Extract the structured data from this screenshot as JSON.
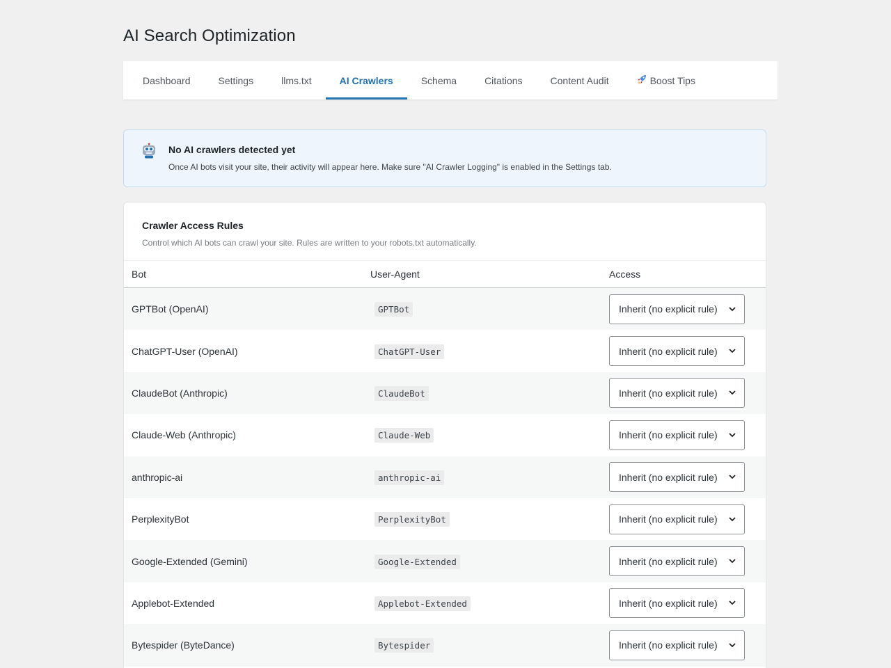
{
  "page": {
    "title": "AI Search Optimization"
  },
  "tabs": [
    {
      "label": "Dashboard"
    },
    {
      "label": "Settings"
    },
    {
      "label": "llms.txt"
    },
    {
      "label": "AI Crawlers",
      "active": true
    },
    {
      "label": "Schema"
    },
    {
      "label": "Citations"
    },
    {
      "label": "Content Audit"
    },
    {
      "label": "Boost Tips",
      "icon": "rocket-icon"
    }
  ],
  "notice": {
    "icon": "robot-icon",
    "title": "No AI crawlers detected yet",
    "text": "Once AI bots visit your site, their activity will appear here. Make sure \"AI Crawler Logging\" is enabled in the Settings tab."
  },
  "rules": {
    "title": "Crawler Access Rules",
    "subtitle": "Control which AI bots can crawl your site. Rules are written to your robots.txt automatically.",
    "columns": [
      "Bot",
      "User-Agent",
      "Access"
    ],
    "rows": [
      {
        "bot": "GPTBot (OpenAI)",
        "ua": "GPTBot",
        "access": "Inherit (no explicit rule)"
      },
      {
        "bot": "ChatGPT-User (OpenAI)",
        "ua": "ChatGPT-User",
        "access": "Inherit (no explicit rule)"
      },
      {
        "bot": "ClaudeBot (Anthropic)",
        "ua": "ClaudeBot",
        "access": "Inherit (no explicit rule)"
      },
      {
        "bot": "Claude-Web (Anthropic)",
        "ua": "Claude-Web",
        "access": "Inherit (no explicit rule)"
      },
      {
        "bot": "anthropic-ai",
        "ua": "anthropic-ai",
        "access": "Inherit (no explicit rule)"
      },
      {
        "bot": "PerplexityBot",
        "ua": "PerplexityBot",
        "access": "Inherit (no explicit rule)"
      },
      {
        "bot": "Google-Extended (Gemini)",
        "ua": "Google-Extended",
        "access": "Inherit (no explicit rule)"
      },
      {
        "bot": "Applebot-Extended",
        "ua": "Applebot-Extended",
        "access": "Inherit (no explicit rule)"
      },
      {
        "bot": "Bytespider (ByteDance)",
        "ua": "Bytespider",
        "access": "Inherit (no explicit rule)"
      }
    ]
  },
  "colors": {
    "accent": "#2271b1",
    "notice_bg": "#eef5fd"
  }
}
